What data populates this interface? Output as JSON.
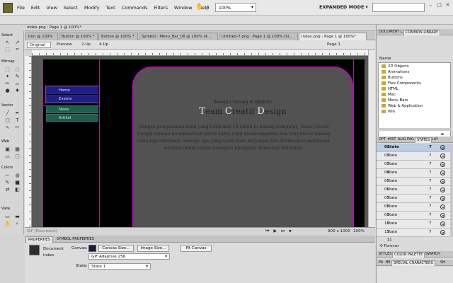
{
  "menubar": {
    "items": [
      "File",
      "Edit",
      "View",
      "Select",
      "Modify",
      "Text",
      "Commands",
      "Filters",
      "Window",
      "Help"
    ],
    "zoom": "100%",
    "mode": "EXPANDED MODE",
    "mode_arrow": "▾"
  },
  "document_window": {
    "title": "index.png : Page 1 @ 100%*"
  },
  "doc_tabs": [
    "tion @ 100%",
    "Button @ 100% *",
    "Button @ 100% *",
    "Symbol : Menu_Bar_08 @ 100% (4 ...",
    "Untitled-7.png : Page 1 @ 100% (Sl...",
    "index.png : Page 1 @ 100%*"
  ],
  "view_bar": {
    "original": "Original",
    "preview": "Preview",
    "two_up": "2-Up",
    "four_up": "4-Up",
    "page": "Page 1"
  },
  "tools": {
    "headers": [
      "Select",
      "Bitmap",
      "Vector",
      "Web",
      "Colors",
      "View"
    ]
  },
  "nav_menu": [
    "Home",
    "Events",
    "News",
    "Artikel"
  ],
  "site": {
    "welcome": "Selamat Datang di Website",
    "brand_parts": [
      "T",
      "eam ",
      "C",
      "reatif ",
      "D",
      "esign"
    ],
    "paragraph": "Dengan pengalaman kami yang lebih dari 15 tahun di bidang komputer, Team Creatif Design mampu menghasilkan karya-karya yang mendunggakan dan berguna di bidang teknologi informasi, semoga apa yang telah kami karyakan dan dedikasikan membawa manfaat untuk semua kalangan pengguna Teknologi Informasi."
  },
  "status_bar": {
    "left": "GIF (Document)",
    "size": "900 x 1000",
    "zoom": "100%"
  },
  "properties": {
    "tabs": [
      "PROPERTIES",
      "SYMBOL PROPERTIES"
    ],
    "doc_label": "Document",
    "doc_name": "index",
    "canvas_label": "Canvas:",
    "canvas_size_btn": "Canvas Size...",
    "image_size_btn": "Image Size...",
    "fit_canvas_btn": "Fit Canvas",
    "format": "GIF Adaptive 256",
    "state_label": "State:",
    "state_value": "State 1"
  },
  "right_panel": {
    "top_tabs": [
      "DOCUMENT L",
      "COMMON LIBRARY"
    ],
    "lib_header": "Name",
    "library": [
      "2D Objects",
      "Animations",
      "Buttons",
      "Flex Components",
      "HTML",
      "Mac",
      "Menu Bars",
      "Web & Application",
      "Win"
    ],
    "state_tabs": [
      "OPT",
      "HIST",
      "ALIG",
      "PAG",
      "STATES",
      "LAY"
    ],
    "states": [
      {
        "num": "01",
        "name": "State 1",
        "val": "7"
      },
      {
        "num": "02",
        "name": "State 2",
        "val": "7"
      },
      {
        "num": "03",
        "name": "State 3",
        "val": "7"
      },
      {
        "num": "04",
        "name": "State 4",
        "val": "7"
      },
      {
        "num": "05",
        "name": "State 5",
        "val": "7"
      },
      {
        "num": "06",
        "name": "State 6",
        "val": "7"
      },
      {
        "num": "07",
        "name": "State 7",
        "val": "7"
      },
      {
        "num": "08",
        "name": "State 8",
        "val": "7"
      },
      {
        "num": "09",
        "name": "State 9",
        "val": "7"
      },
      {
        "num": "10",
        "name": "State 10",
        "val": "7"
      },
      {
        "num": "11",
        "name": "State 11",
        "val": "7"
      }
    ],
    "forever": "Forever",
    "bottom_tabs": [
      "STYLES",
      "COLOR PALETTE",
      "SWATCH"
    ],
    "bottom_tabs2": [
      "PA",
      "BE",
      "SPECIAL CHARACTERS",
      "SH"
    ]
  }
}
